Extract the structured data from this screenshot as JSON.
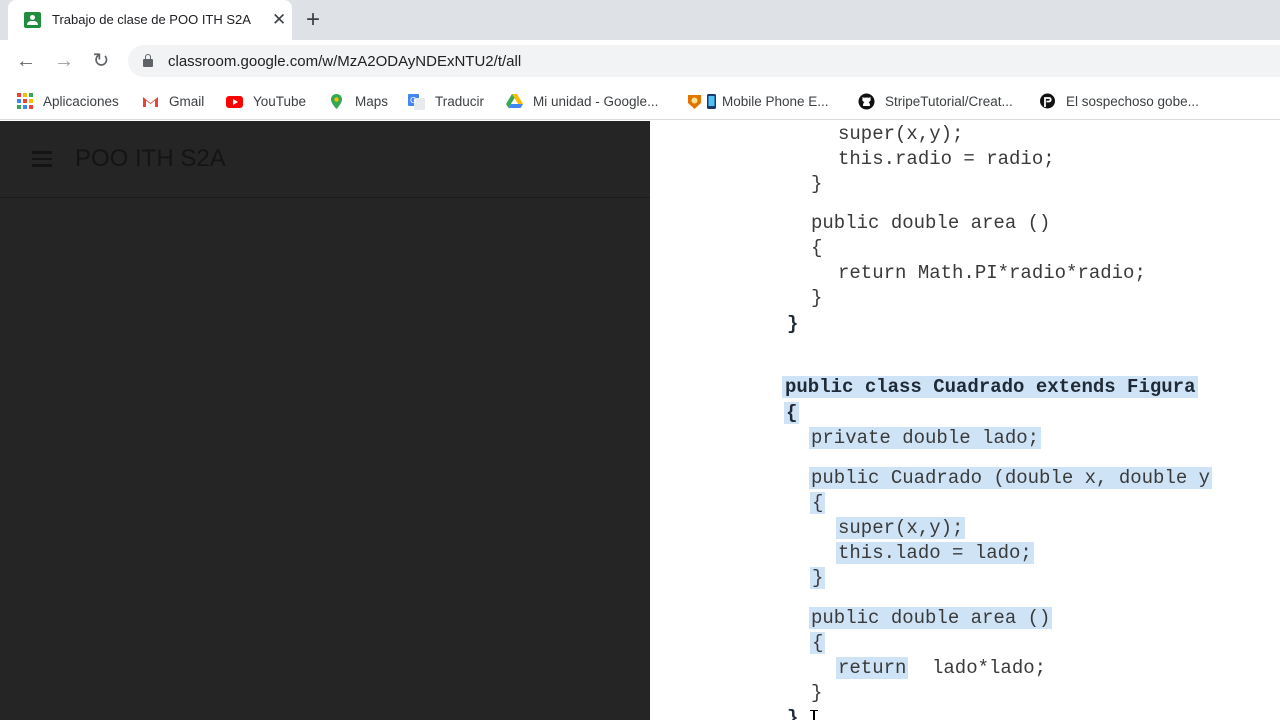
{
  "browser": {
    "tab": {
      "title": "Trabajo de clase de POO ITH S2A",
      "close_glyph": "✕"
    },
    "new_tab_glyph": "+",
    "nav": {
      "back_glyph": "←",
      "forward_glyph": "→",
      "reload_glyph": "↻"
    },
    "url": "classroom.google.com/w/MzA2ODAyNDExNTU2/t/all"
  },
  "bookmarks": [
    {
      "label": "Aplicaciones",
      "icon": "apps-grid-icon"
    },
    {
      "label": "Gmail",
      "icon": "gmail-icon"
    },
    {
      "label": "YouTube",
      "icon": "youtube-icon"
    },
    {
      "label": "Maps",
      "icon": "maps-icon"
    },
    {
      "label": "Traducir",
      "icon": "translate-icon"
    },
    {
      "label": "Mi unidad - Google...",
      "icon": "drive-icon"
    },
    {
      "label": "Mobile Phone E...",
      "icon": "mobile-phone-icon"
    },
    {
      "label": "StripeTutorial/Creat...",
      "icon": "github-icon"
    },
    {
      "label": "El sospechoso gobe...",
      "icon": "podcast-icon"
    }
  ],
  "classroom": {
    "title": "POO ITH S2A"
  },
  "code": {
    "lines": [
      "super(x,y);",
      "this.radio = radio;",
      "}",
      "public double area ()",
      "{",
      "return Math.PI*radio*radio;",
      "}",
      "}",
      "public class Cuadrado extends Figura",
      "{",
      "private double lado;",
      "public Cuadrado (double x, double y",
      "{",
      "super(x,y);",
      "this.lado = lado;",
      "}",
      "public double area ()",
      "{",
      "return",
      "lado*lado;",
      "}",
      "}"
    ]
  },
  "colors": {
    "selection_highlight": "#cfe3f6",
    "dark_panel": "#252525",
    "tab_strip": "#dee1e6"
  }
}
